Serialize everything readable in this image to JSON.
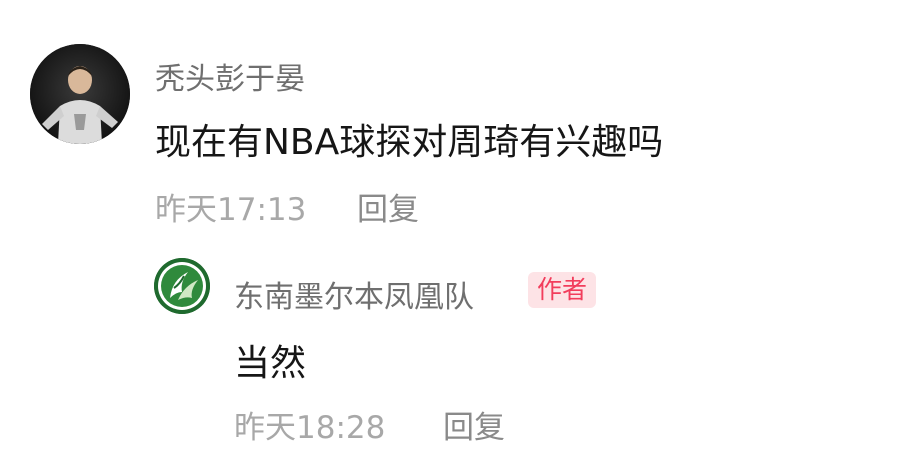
{
  "comment": {
    "username": "秃头彭于晏",
    "text": "现在有NBA球探对周琦有兴趣吗",
    "time": "昨天17:13",
    "reply_label": "回复"
  },
  "reply": {
    "username": "东南墨尔本凤凰队",
    "badge": "作者",
    "text": "当然",
    "time": "昨天18:28",
    "reply_label": "回复"
  },
  "colors": {
    "badge_text": "#f23d5c",
    "badge_bg": "#fde3e6",
    "username": "#6f6f6f",
    "meta": "#a8a8a8"
  }
}
